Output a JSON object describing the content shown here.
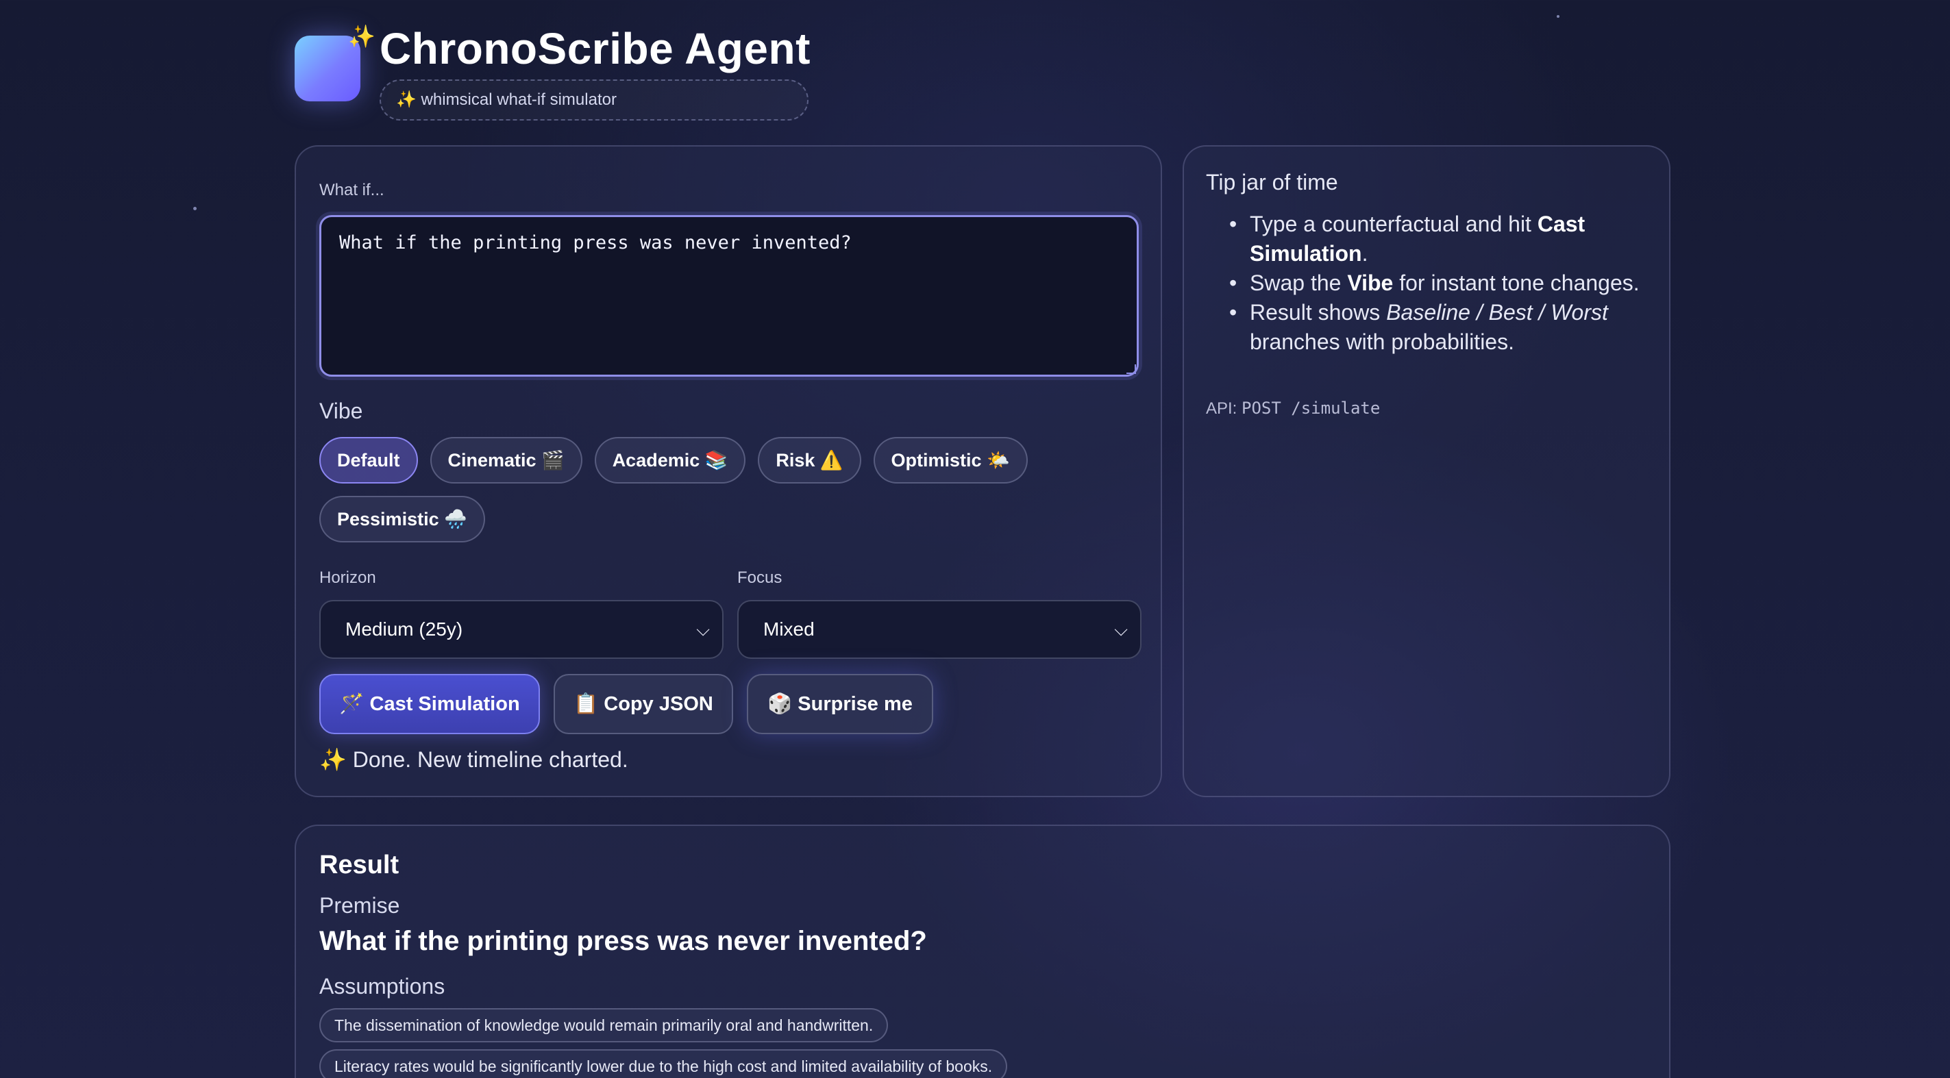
{
  "app": {
    "title": "ChronoScribe Agent",
    "subtitle": "✨ whimsical what-if simulator"
  },
  "input": {
    "label": "What if...",
    "value": "What if the printing press was never invented?"
  },
  "vibe": {
    "title": "Vibe",
    "options": [
      "Default",
      "Cinematic 🎬",
      "Academic 📚",
      "Risk ⚠️",
      "Optimistic 🌤️",
      "Pessimistic 🌧️"
    ],
    "selected": "Default"
  },
  "horizon": {
    "label": "Horizon",
    "value": "Medium (25y)"
  },
  "focus": {
    "label": "Focus",
    "value": "Mixed"
  },
  "actions": {
    "cast": "🪄 Cast Simulation",
    "copy": "📋 Copy JSON",
    "surprise": "🎲 Surprise me"
  },
  "status": {
    "icon": "✨",
    "text": "Done. New timeline charted."
  },
  "tips": {
    "title": "Tip jar of time",
    "items": [
      {
        "pre": "Type a counterfactual and hit ",
        "strong": "Cast Simulation",
        "post": "."
      },
      {
        "pre": "Swap the ",
        "strong": "Vibe",
        "post": " for instant tone changes."
      },
      {
        "pre": "Result shows ",
        "em": "Baseline / Best / Worst",
        "post": " branches with probabilities."
      }
    ],
    "api_label": "API:",
    "api_value": "POST /simulate"
  },
  "result": {
    "title": "Result",
    "premise_label": "Premise",
    "premise": "What if the printing press was never invented?",
    "assumptions_label": "Assumptions",
    "assumptions": [
      "The dissemination of knowledge would remain primarily oral and handwritten.",
      "Literacy rates would be significantly lower due to the high cost and limited availability of books."
    ]
  },
  "colors": {
    "accent": "#8f8ee8",
    "primary_button": "#4a4fd0",
    "background": "#1a1e3c"
  }
}
